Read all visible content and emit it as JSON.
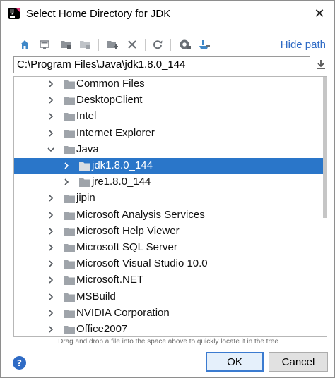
{
  "window": {
    "title": "Select Home Directory for JDK",
    "close_glyph": "✕"
  },
  "toolbar": {
    "buttons": [
      {
        "name": "home-icon"
      },
      {
        "name": "desktop-icon"
      },
      {
        "name": "project-folder-icon"
      },
      {
        "name": "module-folder-icon"
      },
      {
        "name": "new-folder-icon"
      },
      {
        "name": "delete-icon"
      },
      {
        "name": "refresh-icon"
      },
      {
        "name": "show-hidden-icon"
      },
      {
        "name": "sdk-icon"
      }
    ],
    "hide_path_label": "Hide path"
  },
  "path": {
    "value": "C:\\Program Files\\Java\\jdk1.8.0_144"
  },
  "tree": {
    "items": [
      {
        "label": "Common Files",
        "level": 0,
        "expanded": false,
        "selected": false
      },
      {
        "label": "DesktopClient",
        "level": 0,
        "expanded": false,
        "selected": false
      },
      {
        "label": "Intel",
        "level": 0,
        "expanded": false,
        "selected": false
      },
      {
        "label": "Internet Explorer",
        "level": 0,
        "expanded": false,
        "selected": false
      },
      {
        "label": "Java",
        "level": 0,
        "expanded": true,
        "selected": false
      },
      {
        "label": "jdk1.8.0_144",
        "level": 1,
        "expanded": false,
        "selected": true
      },
      {
        "label": "jre1.8.0_144",
        "level": 1,
        "expanded": false,
        "selected": false
      },
      {
        "label": "jipin",
        "level": 0,
        "expanded": false,
        "selected": false
      },
      {
        "label": "Microsoft Analysis Services",
        "level": 0,
        "expanded": false,
        "selected": false
      },
      {
        "label": "Microsoft Help Viewer",
        "level": 0,
        "expanded": false,
        "selected": false
      },
      {
        "label": "Microsoft SQL Server",
        "level": 0,
        "expanded": false,
        "selected": false
      },
      {
        "label": "Microsoft Visual Studio 10.0",
        "level": 0,
        "expanded": false,
        "selected": false
      },
      {
        "label": "Microsoft.NET",
        "level": 0,
        "expanded": false,
        "selected": false
      },
      {
        "label": "MSBuild",
        "level": 0,
        "expanded": false,
        "selected": false
      },
      {
        "label": "NVIDIA Corporation",
        "level": 0,
        "expanded": false,
        "selected": false
      },
      {
        "label": "Office2007",
        "level": 0,
        "expanded": false,
        "selected": false
      }
    ]
  },
  "hint": "Drag and drop a file into the space above to quickly locate it in the tree",
  "footer": {
    "help_glyph": "?",
    "ok_label": "OK",
    "cancel_label": "Cancel"
  },
  "colors": {
    "accent": "#2f6bc5",
    "selection": "#2a76c9",
    "folder": "#9fa4aa",
    "folder_selected": "#d8dde3"
  }
}
